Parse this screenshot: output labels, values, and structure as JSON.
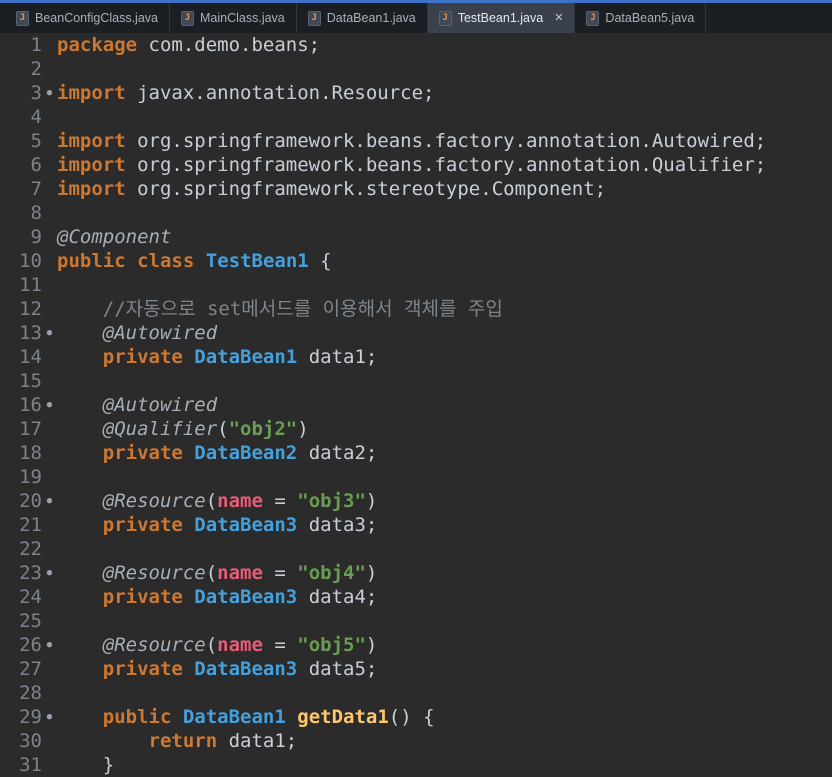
{
  "window": {
    "title": "TestBean1.java"
  },
  "colors": {
    "accent_top": "#3C72C8",
    "editor_bg": "#2B2B2B",
    "tabbar_bg": "#1B1E23",
    "active_tab_bg": "#3A414D",
    "keyword": "#CC7832",
    "type": "#45A1DE",
    "string": "#699E52",
    "annotation": "#A6AEB8",
    "comment": "#7D858D",
    "attr_name": "#E25D75",
    "method": "#FFC66D",
    "plain": "#C8CFD8",
    "line_number": "#7B838D"
  },
  "icons": {
    "java_file_letter": "J",
    "close": "✕",
    "gutter_dot": "●"
  },
  "tabs": [
    {
      "label": "BeanConfigClass.java",
      "active": false
    },
    {
      "label": "MainClass.java",
      "active": false
    },
    {
      "label": "DataBean1.java",
      "active": false
    },
    {
      "label": "TestBean1.java",
      "active": true,
      "close": "✕"
    },
    {
      "label": "DataBean5.java",
      "active": false
    }
  ],
  "editor": {
    "language": "java",
    "lines": [
      {
        "n": "1",
        "m": false,
        "toks": [
          [
            "k",
            "package"
          ],
          [
            "p",
            " com.demo.beans;"
          ]
        ]
      },
      {
        "n": "2",
        "m": false,
        "toks": []
      },
      {
        "n": "3",
        "m": true,
        "toks": [
          [
            "k",
            "import"
          ],
          [
            "p",
            " javax.annotation.Resource;"
          ]
        ]
      },
      {
        "n": "4",
        "m": false,
        "toks": []
      },
      {
        "n": "5",
        "m": false,
        "toks": [
          [
            "k",
            "import"
          ],
          [
            "p",
            " org.springframework.beans.factory.annotation.Autowired;"
          ]
        ]
      },
      {
        "n": "6",
        "m": false,
        "toks": [
          [
            "k",
            "import"
          ],
          [
            "p",
            " org.springframework.beans.factory.annotation.Qualifier;"
          ]
        ]
      },
      {
        "n": "7",
        "m": false,
        "toks": [
          [
            "k",
            "import"
          ],
          [
            "p",
            " org.springframework.stereotype.Component;"
          ]
        ]
      },
      {
        "n": "8",
        "m": false,
        "toks": []
      },
      {
        "n": "9",
        "m": false,
        "toks": [
          [
            "a",
            "@Component"
          ]
        ]
      },
      {
        "n": "10",
        "m": false,
        "toks": [
          [
            "k",
            "public"
          ],
          [
            "p",
            " "
          ],
          [
            "k",
            "class"
          ],
          [
            "p",
            " "
          ],
          [
            "t",
            "TestBean1"
          ],
          [
            "p",
            " {"
          ]
        ]
      },
      {
        "n": "11",
        "m": false,
        "toks": []
      },
      {
        "n": "12",
        "m": false,
        "toks": [
          [
            "c",
            "    //자동으로 set메서드를 이용해서 객체를 주입"
          ]
        ]
      },
      {
        "n": "13",
        "m": true,
        "toks": [
          [
            "p",
            "    "
          ],
          [
            "a",
            "@Autowired"
          ]
        ]
      },
      {
        "n": "14",
        "m": false,
        "toks": [
          [
            "p",
            "    "
          ],
          [
            "k",
            "private"
          ],
          [
            "p",
            " "
          ],
          [
            "t",
            "DataBean1"
          ],
          [
            "p",
            " data1;"
          ]
        ]
      },
      {
        "n": "15",
        "m": false,
        "toks": []
      },
      {
        "n": "16",
        "m": true,
        "toks": [
          [
            "p",
            "    "
          ],
          [
            "a",
            "@Autowired"
          ]
        ]
      },
      {
        "n": "17",
        "m": false,
        "toks": [
          [
            "p",
            "    "
          ],
          [
            "a",
            "@Qualifier"
          ],
          [
            "p",
            "("
          ],
          [
            "s",
            "\"obj2\""
          ],
          [
            "p",
            ")"
          ]
        ]
      },
      {
        "n": "18",
        "m": false,
        "toks": [
          [
            "p",
            "    "
          ],
          [
            "k",
            "private"
          ],
          [
            "p",
            " "
          ],
          [
            "t",
            "DataBean2"
          ],
          [
            "p",
            " data2;"
          ]
        ]
      },
      {
        "n": "19",
        "m": false,
        "toks": []
      },
      {
        "n": "20",
        "m": true,
        "toks": [
          [
            "p",
            "    "
          ],
          [
            "a",
            "@Resource"
          ],
          [
            "p",
            "("
          ],
          [
            "n",
            "name"
          ],
          [
            "p",
            " = "
          ],
          [
            "s",
            "\"obj3\""
          ],
          [
            "p",
            ")"
          ]
        ]
      },
      {
        "n": "21",
        "m": false,
        "toks": [
          [
            "p",
            "    "
          ],
          [
            "k",
            "private"
          ],
          [
            "p",
            " "
          ],
          [
            "t",
            "DataBean3"
          ],
          [
            "p",
            " data3;"
          ]
        ]
      },
      {
        "n": "22",
        "m": false,
        "toks": []
      },
      {
        "n": "23",
        "m": true,
        "toks": [
          [
            "p",
            "    "
          ],
          [
            "a",
            "@Resource"
          ],
          [
            "p",
            "("
          ],
          [
            "n",
            "name"
          ],
          [
            "p",
            " = "
          ],
          [
            "s",
            "\"obj4\""
          ],
          [
            "p",
            ")"
          ]
        ]
      },
      {
        "n": "24",
        "m": false,
        "toks": [
          [
            "p",
            "    "
          ],
          [
            "k",
            "private"
          ],
          [
            "p",
            " "
          ],
          [
            "t",
            "DataBean3"
          ],
          [
            "p",
            " data4;"
          ]
        ]
      },
      {
        "n": "25",
        "m": false,
        "toks": []
      },
      {
        "n": "26",
        "m": true,
        "toks": [
          [
            "p",
            "    "
          ],
          [
            "a",
            "@Resource"
          ],
          [
            "p",
            "("
          ],
          [
            "n",
            "name"
          ],
          [
            "p",
            " = "
          ],
          [
            "s",
            "\"obj5\""
          ],
          [
            "p",
            ")"
          ]
        ]
      },
      {
        "n": "27",
        "m": false,
        "toks": [
          [
            "p",
            "    "
          ],
          [
            "k",
            "private"
          ],
          [
            "p",
            " "
          ],
          [
            "t",
            "DataBean3"
          ],
          [
            "p",
            " data5;"
          ]
        ]
      },
      {
        "n": "28",
        "m": false,
        "toks": []
      },
      {
        "n": "29",
        "m": true,
        "toks": [
          [
            "p",
            "    "
          ],
          [
            "k",
            "public"
          ],
          [
            "p",
            " "
          ],
          [
            "t",
            "DataBean1"
          ],
          [
            "p",
            " "
          ],
          [
            "m",
            "getData1"
          ],
          [
            "p",
            "() {"
          ]
        ]
      },
      {
        "n": "30",
        "m": false,
        "toks": [
          [
            "p",
            "        "
          ],
          [
            "k",
            "return"
          ],
          [
            "p",
            " data1;"
          ]
        ]
      },
      {
        "n": "31",
        "m": false,
        "toks": [
          [
            "p",
            "    }"
          ]
        ]
      }
    ]
  }
}
